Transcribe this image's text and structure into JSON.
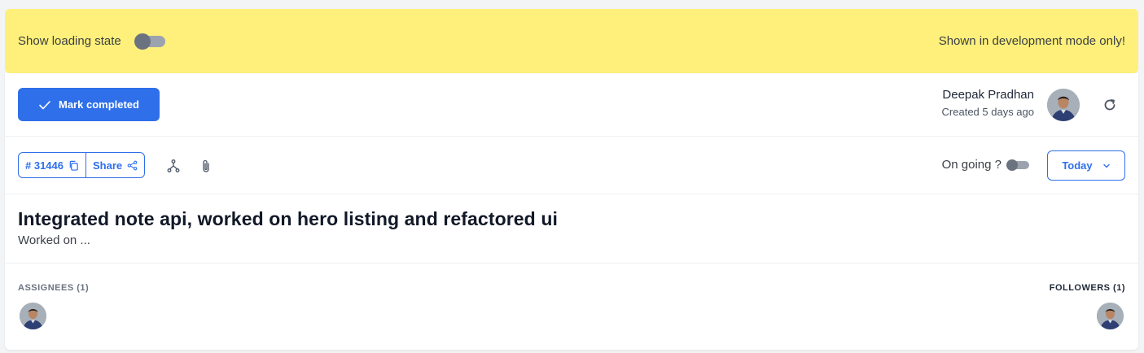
{
  "dev_banner": {
    "loading_label": "Show loading state",
    "note": "Shown in development mode only!"
  },
  "header": {
    "mark_completed_label": "Mark completed",
    "author_name": "Deepak Pradhan",
    "created_text": "Created 5 days ago"
  },
  "meta": {
    "task_id": "# 31446",
    "share_label": "Share",
    "ongoing_label": "On going ?",
    "date_select_value": "Today"
  },
  "task": {
    "title": "Integrated note api, worked on hero listing and refactored ui",
    "description": "Worked on ..."
  },
  "people": {
    "assignees_label": "ASSIGNEES (1)",
    "followers_label": "FOLLOWERS (1)"
  },
  "colors": {
    "accent": "#2f6fea",
    "dev_banner_bg": "#fef07a"
  },
  "icons": [
    "check-icon",
    "refresh-icon",
    "copy-icon",
    "share-icon",
    "subtask-icon",
    "paperclip-icon",
    "chevron-down-icon"
  ]
}
